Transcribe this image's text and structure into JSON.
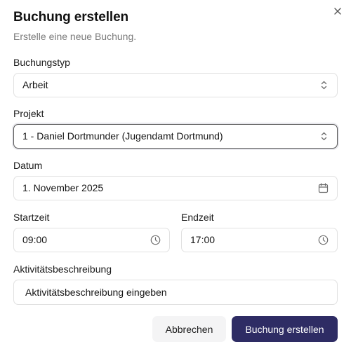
{
  "dialog": {
    "title": "Buchung erstellen",
    "subtitle": "Erstelle eine neue Buchung."
  },
  "fields": {
    "buchungstyp": {
      "label": "Buchungstyp",
      "value": "Arbeit",
      "icon": "chevron-up-down-icon"
    },
    "projekt": {
      "label": "Projekt",
      "value": "1 - Daniel Dortmunder (Jugendamt Dortmund)",
      "icon": "chevron-up-down-icon"
    },
    "datum": {
      "label": "Datum",
      "value": "1. November 2025",
      "icon": "calendar-icon"
    },
    "startzeit": {
      "label": "Startzeit",
      "value": "09:00",
      "icon": "clock-icon"
    },
    "endzeit": {
      "label": "Endzeit",
      "value": "17:00",
      "icon": "clock-icon"
    },
    "beschreibung": {
      "label": "Aktivitätsbeschreibung",
      "placeholder": "Aktivitätsbeschreibung eingeben"
    }
  },
  "buttons": {
    "cancel": "Abbrechen",
    "submit": "Buchung erstellen"
  },
  "colors": {
    "primary": "#2e2c64",
    "muted_text": "#7a7a7a",
    "border": "#e1e1e1",
    "secondary_bg": "#f4f4f5"
  }
}
